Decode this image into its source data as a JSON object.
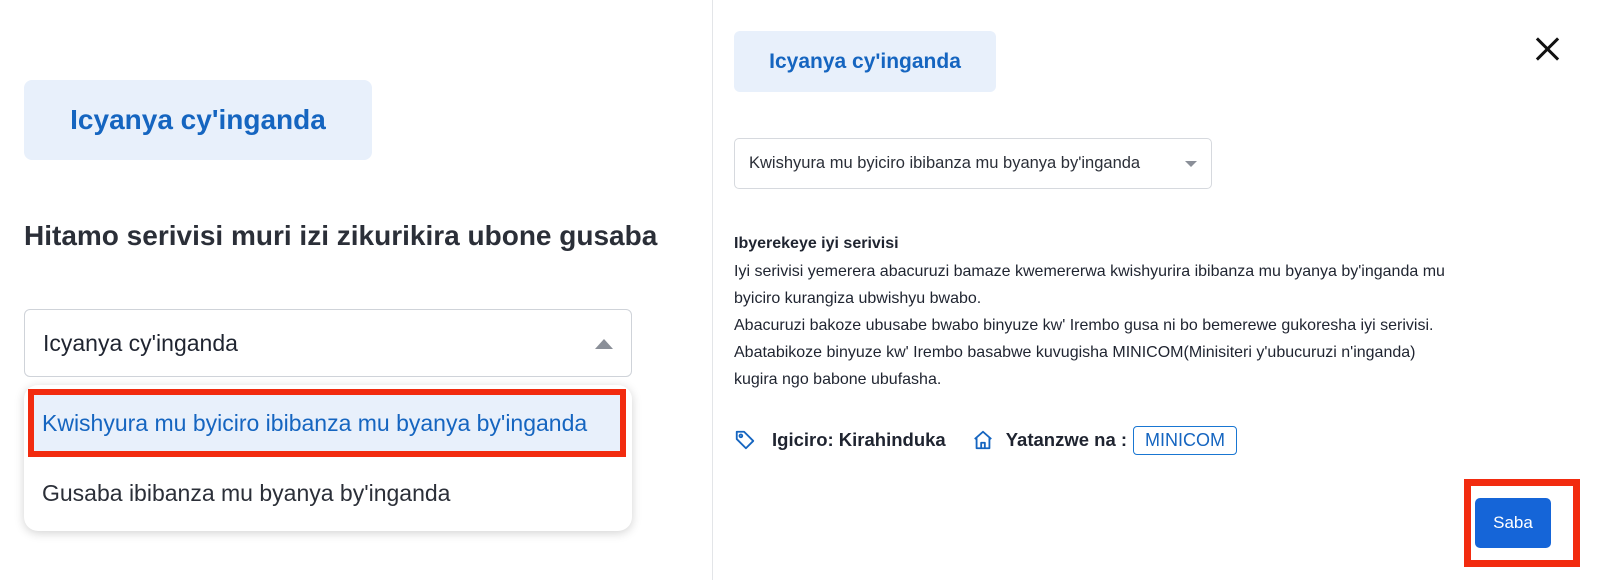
{
  "left": {
    "badge": "Icyanya cy'inganda",
    "heading": "Hitamo serivisi muri izi zikurikira ubone gusaba",
    "select_value": "Icyanya cy'inganda",
    "options": [
      "Kwishyura mu byiciro ibibanza mu byanya by'inganda",
      "Gusaba ibibanza mu byanya by'inganda"
    ]
  },
  "right": {
    "badge": "Icyanya cy'inganda",
    "select_value": "Kwishyura mu byiciro ibibanza mu byanya by'inganda",
    "about_title": "Ibyerekeye iyi serivisi",
    "about_lines": [
      "Iyi serivisi yemerera abacuruzi bamaze kwemererwa kwishyurira ibibanza mu byanya by'inganda mu",
      "byiciro kurangiza ubwishyu bwabo.",
      "Abacuruzi bakoze ubusabe bwabo binyuze kw' Irembo gusa ni bo bemerewe gukoresha iyi serivisi.",
      "Abatabikoze binyuze kw' Irembo basabwe kuvugisha MINICOM(Minisiteri y'ubucuruzi n'inganda)",
      "kugira ngo babone ubufasha."
    ],
    "price_label": "Igiciro: Kirahinduka",
    "provider_label": "Yatanzwe na :",
    "provider": "MINICOM",
    "submit_label": "Saba"
  },
  "icons": {
    "tag": "tag-icon",
    "institution": "institution-icon",
    "close": "close-icon"
  },
  "colors": {
    "accent": "#1565c0",
    "highlight_bg": "#e8f0fb",
    "annotation_red": "#f22b0f",
    "button_blue": "#1565d8"
  }
}
